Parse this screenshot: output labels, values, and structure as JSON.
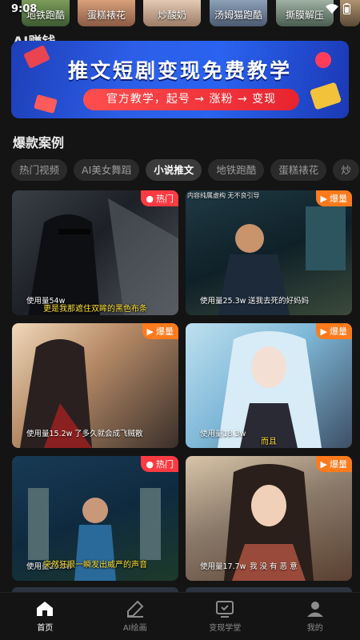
{
  "status": {
    "time": "9:08"
  },
  "top_strip": [
    {
      "label": "地铁跑酷"
    },
    {
      "label": "蛋糕裱花"
    },
    {
      "label": "炒酸奶"
    },
    {
      "label": "汤姆猫跑酷"
    },
    {
      "label": "撕膜解压"
    }
  ],
  "section_peek": "AI赚钱",
  "banner": {
    "title": "推文短剧变现免费教学",
    "pill": "官方教学，起号 → 涨粉 → 变现"
  },
  "hits_section": {
    "title": "爆款案例"
  },
  "tabs": [
    {
      "label": "热门视频",
      "active": false
    },
    {
      "label": "AI美女舞蹈",
      "active": false
    },
    {
      "label": "小说推文",
      "active": true
    },
    {
      "label": "地铁跑酷",
      "active": false
    },
    {
      "label": "蛋糕裱花",
      "active": false
    },
    {
      "label": "炒",
      "active": false
    }
  ],
  "cards": [
    {
      "badge": "热门",
      "badge_type": "hot",
      "usage": "使用量54w",
      "caption": "更是我那遮住双眸的黑色布条",
      "note": ""
    },
    {
      "badge": "爆量",
      "badge_type": "boom",
      "usage": "使用量25.3w",
      "caption": "送我去死的好妈妈",
      "note": "内容纯属虚构 无不良引导"
    },
    {
      "badge": "爆量",
      "badge_type": "boom",
      "usage": "使用量15.2w",
      "caption": "了多久就会成飞贼散",
      "note": ""
    },
    {
      "badge": "爆量",
      "badge_type": "boom",
      "usage": "使用量18.3w",
      "caption": "而且",
      "note": ""
    },
    {
      "badge": "热门",
      "badge_type": "hot",
      "usage": "使用量29.5w",
      "caption": "突然狂眼一瞬发出威严的声音",
      "note": ""
    },
    {
      "badge": "爆量",
      "badge_type": "boom",
      "usage": "使用量17.7w",
      "caption": "我 没 有 恶 意",
      "note": ""
    }
  ],
  "bottom_nav": [
    {
      "label": "首页",
      "icon": "home-icon",
      "active": true
    },
    {
      "label": "AI绘画",
      "icon": "brush-icon",
      "active": false
    },
    {
      "label": "变现学堂",
      "icon": "classroom-icon",
      "active": false
    },
    {
      "label": "我的",
      "icon": "user-icon",
      "active": false
    }
  ],
  "colors": {
    "background": "#141414",
    "hot_badge": "#ff3b42",
    "boom_badge": "#ff7a1c",
    "banner_blue": "#2c5ee8",
    "pill_red": "#e8232f",
    "caption_yellow": "#ffe23a"
  }
}
